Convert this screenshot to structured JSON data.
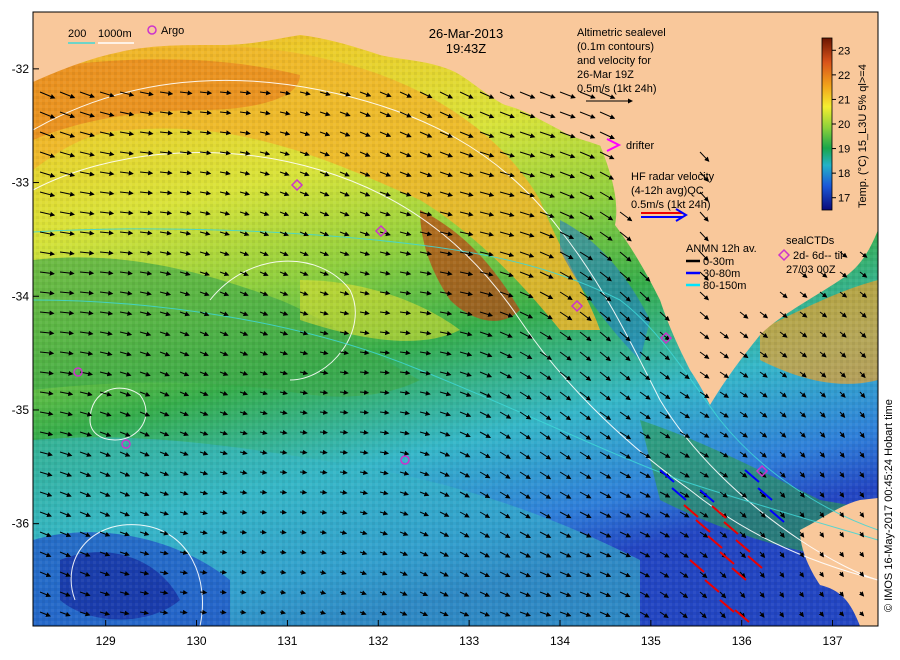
{
  "title": {
    "date": "26-Mar-2013",
    "time": "19:43Z"
  },
  "map": {
    "axes": {
      "lon_ticks": [
        "129",
        "130",
        "131",
        "132",
        "133",
        "134",
        "135",
        "136",
        "137"
      ],
      "lat_ticks": [
        "-32",
        "-33",
        "-34",
        "-35",
        "-36"
      ],
      "lon_range": [
        128.2,
        137.5
      ],
      "lat_range": [
        -36.9,
        -31.5
      ]
    }
  },
  "legend": {
    "isobath": {
      "val1": "200",
      "val2": "1000m"
    },
    "argo": "Argo",
    "altimetry": {
      "line1": "Altimetric sealevel",
      "line2": "(0.1m contours)",
      "line3": "and velocity for",
      "line4": "26-Mar 19Z",
      "scale": "0.5m/s (1kt 24h)"
    },
    "drifter": "drifter",
    "hf_radar": {
      "line1": "HF radar velocity",
      "line2": "(4-12h avg)QC",
      "scale": "0.5m/s (1kt 24h)"
    },
    "anmn": {
      "title": "ANMN 12h av.",
      "items": [
        {
          "label": "0-30m",
          "color": "#000000"
        },
        {
          "label": "30-80m",
          "color": "#0000ff"
        },
        {
          "label": "80-150m",
          "color": "#00e5ff"
        }
      ]
    },
    "seal": {
      "title": "sealCTDs",
      "line2": "2d- 6d-- til",
      "line3": "27/03 00Z"
    }
  },
  "colorbar": {
    "ticks": [
      "23",
      "22",
      "21",
      "20",
      "19",
      "18",
      "17"
    ],
    "range": [
      16.5,
      23.5
    ],
    "label": "Temp. (°C) 15_L3U 5% ql>=4"
  },
  "credit": "© IMOS 16-May-2017 00:45:24 Hobart time",
  "colors": {
    "land": "#f9c89b",
    "argo": "#cc33cc",
    "seal": "#cc33cc",
    "drifter": "#ff00ff",
    "hf_red": "#ee0000",
    "hf_blue": "#0000ff"
  }
}
